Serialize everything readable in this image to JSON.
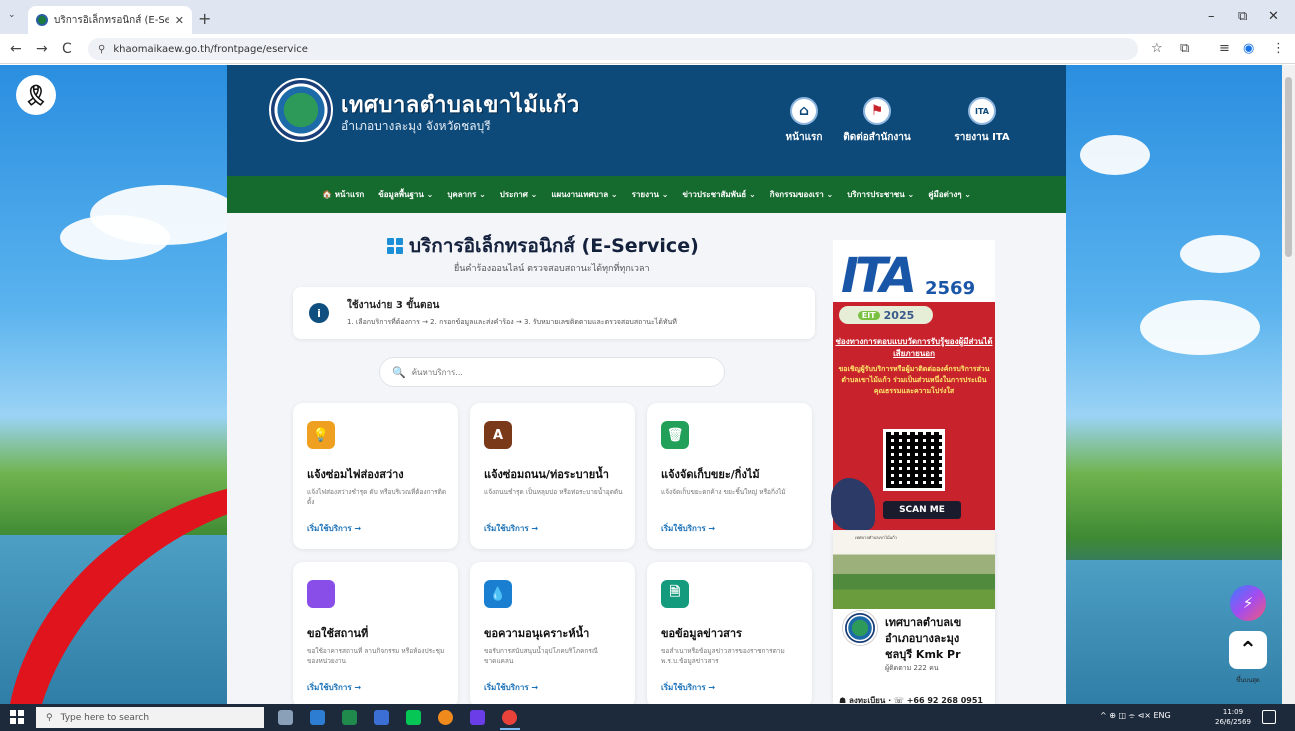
{
  "browser": {
    "tab_title": "บริการอิเล็กทรอนิกส์ (E-Service) | เ",
    "tab_close": "✕",
    "new_tab": "+",
    "tab_menu": "⌄",
    "window_buttons": {
      "minimize": "–",
      "restore": "⧉",
      "close": "✕"
    },
    "back": "←",
    "forward": "→",
    "reload": "C",
    "url": "khaomaikaew.go.th/frontpage/eservice",
    "site_icon": "⚲",
    "tools": {
      "star": "☆",
      "extensions": "⧉",
      "reading": "≡",
      "profile": "◉",
      "menu": "⋮"
    }
  },
  "header": {
    "site_name": "เทศบาลตำบลเขาไม้แก้ว",
    "site_sub": "อำเภอบางละมุง จังหวัดชลบุรี",
    "buttons": [
      {
        "label": "หน้าแรก",
        "icon": "⌂"
      },
      {
        "label": "ติดต่อสำนักงาน",
        "icon": "⚑"
      },
      {
        "label": "รายงาน ITA",
        "icon": "ITA"
      }
    ]
  },
  "nav": [
    "🏠 หน้าแรก",
    "ข้อมูลพื้นฐาน ⌄",
    "บุคลากร ⌄",
    "ประกาศ ⌄",
    "แผนงานเทศบาล ⌄",
    "รายงาน ⌄",
    "ข่าวประชาสัมพันธ์ ⌄",
    "กิจกรรมของเรา ⌄",
    "บริการประชาชน ⌄",
    "คู่มือต่างๆ ⌄"
  ],
  "service": {
    "title": "บริการอิเล็กทรอนิกส์ (E-Service)",
    "subtitle": "ยื่นคำร้องออนไลน์ ตรวจสอบสถานะได้ทุกที่ทุกเวลา",
    "steps_icon": "i",
    "steps_title": "ใช้งานง่าย 3 ขั้นตอน",
    "steps_text": "1. เลือกบริการที่ต้องการ → 2. กรอกข้อมูลและส่งคำร้อง → 3. รับหมายเลขติดตามและตรวจสอบสถานะได้ทันที",
    "search_icon": "🔍",
    "search_placeholder": "ค้นหาบริการ..."
  },
  "cards": [
    {
      "title": "แจ้งซ่อมไฟส่องสว่าง",
      "desc": "แจ้งไฟส่องสว่างชำรุด ดับ หรือบริเวณที่ต้องการติดตั้ง",
      "link": "เริ่มใช้บริการ →",
      "icon": "💡",
      "color": "#f0a020"
    },
    {
      "title": "แจ้งซ่อมถนน/ท่อระบายน้ำ",
      "desc": "แจ้งถนนชำรุด เป็นหลุมบ่อ หรือท่อระบายน้ำอุดตัน",
      "link": "เริ่มใช้บริการ →",
      "icon": "A",
      "color": "#7a3a1a"
    },
    {
      "title": "แจ้งจัดเก็บขยะ/กิ่งไม้",
      "desc": "แจ้งจัดเก็บขยะตกค้าง ขยะชิ้นใหญ่ หรือกิ่งไม้",
      "link": "เริ่มใช้บริการ →",
      "icon": "🗑",
      "color": "#22a05a"
    },
    {
      "title": "ขอใช้สถานที่",
      "desc": "ขอใช้อาคารสถานที่ ลานกิจกรรม หรือห้องประชุมของหน่วยงาน",
      "link": "เริ่มใช้บริการ →",
      "icon": "",
      "color": "#8a4ee8"
    },
    {
      "title": "ขอความอนุเคราะห์น้ำ",
      "desc": "ขอรับการสนับสนุนน้ำอุปโภคบริโภคกรณีขาดแคลน",
      "link": "เริ่มใช้บริการ →",
      "icon": "💧",
      "color": "#1a7fd0"
    },
    {
      "title": "ขอข้อมูลข่าวสาร",
      "desc": "ขอสำเนาหรือข้อมูลข่าวสารของราชการตาม พ.ร.บ.ข้อมูลข่าวสาร",
      "link": "เริ่มใช้บริการ →",
      "icon": "🗎",
      "color": "#149a7c"
    }
  ],
  "ita_banner": {
    "logo": "ITA",
    "year": "2569",
    "eit_pill": "EIT",
    "eit_year": "2025",
    "heading": "ช่องทางการตอบแบบวัดการรับรู้ของผู้มีส่วนได้เสียภายนอก",
    "invite": "ขอเชิญผู้รับบริการหรือผู้มาติดต่อองค์กรบริการส่วนตำบลเขาไม้แก้ว ร่วมเป็นส่วนหนึ่งในการประเมินคุณธรรมและความโปร่งใส",
    "scan": "SCAN ME"
  },
  "fb_card": {
    "cover_text": "เทศบาลตำบลเขาไม้แก้ว",
    "name_line1": "เทศบาลตำบลเข",
    "name_line2": "อำเภอบางละมุง",
    "name_line3": "ชลบุรี Kmk Pr",
    "followers": "ผู้ติดตาม 222 คน",
    "contact": "☗ ลงทะเบียน · ☏ +66 92 268 0951"
  },
  "floating": {
    "ribbon": "🎗",
    "messenger": "⚡",
    "totop": "⌃",
    "totop_label": "ขึ้นบนสุด"
  },
  "taskbar": {
    "search_icon": "⚲",
    "search_placeholder": "Type here to search",
    "tray": "^ ⊕ ◫ ⌯ ⊲× ENG",
    "time": "11:09",
    "date": "26/6/2569"
  }
}
